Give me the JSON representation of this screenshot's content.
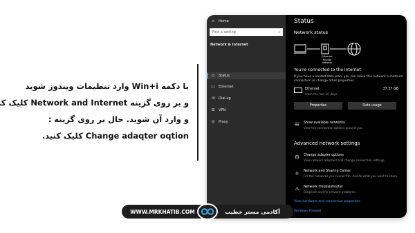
{
  "caption": {
    "lines": [
      "با دکمه Win+i وارد تنظیمات ویندوز شوید",
      "و بر روی گزینه Network and Internet کلیک کرده",
      "و وارد آن شوید. حال بر روی گزینه :",
      "Change adaqter oqtion کلیک کنید."
    ]
  },
  "footer": {
    "website": "WWW.MRKHATIB.COM",
    "brand": "آکادمی مستر خطیب",
    "brand_color": "#1d1d1d"
  },
  "settings": {
    "sidebar": {
      "home": "Home",
      "search_placeholder": "Find a setting",
      "section": "Network & Internet",
      "items": [
        {
          "label": "Status",
          "icon": "status-icon"
        },
        {
          "label": "Ethernet",
          "icon": "ethernet-icon"
        },
        {
          "label": "Dial-up",
          "icon": "dialup-icon"
        },
        {
          "label": "VPN",
          "icon": "vpn-icon"
        },
        {
          "label": "Proxy",
          "icon": "proxy-icon"
        }
      ]
    },
    "main": {
      "title": "Status",
      "network_status": "Network status",
      "diagram_labels": {
        "ethernet": "Ethernet",
        "network": "Private network"
      },
      "connected": "You're connected to the Internet",
      "limited_note": "If you have a limited data plan, you can make this network a metered connection or change other properties.",
      "adapter": {
        "name": "Ethernet",
        "period": "From the last 30 days",
        "usage": "37.37 GB"
      },
      "properties_button": "Properties",
      "data_usage_button": "Data usage",
      "show_networks": {
        "title": "Show available networks",
        "desc": "View the connection options around you."
      },
      "advanced_heading": "Advanced network settings",
      "change_adapter": {
        "title": "Change adapter options",
        "desc": "View network adapters and change connection settings."
      },
      "sharing_center": {
        "title": "Network and Sharing Center",
        "desc": "For the networks you connect to, decide what you want to share."
      },
      "troubleshooter": {
        "title": "Network troubleshooter",
        "desc": "Diagnose and fix network problems."
      },
      "link_hardware": "View hardware and connection properties",
      "link_firewall": "Windows Firewall"
    },
    "accent_color": "#3c9bd6",
    "link_color": "#4da3ff"
  }
}
